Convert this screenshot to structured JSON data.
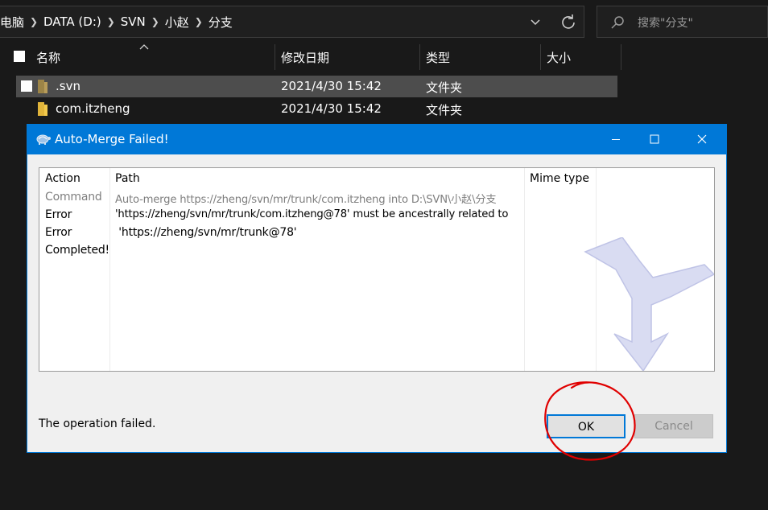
{
  "explorer": {
    "breadcrumbs": [
      "电脑",
      "DATA (D:)",
      "SVN",
      "小赵",
      "分支"
    ],
    "search_placeholder": "搜索\"分支\"",
    "columns": [
      "名称",
      "修改日期",
      "类型",
      "大小"
    ],
    "files": [
      {
        "name": ".svn",
        "date": "2021/4/30 15:42",
        "type": "文件夹",
        "selected": true
      },
      {
        "name": "com.itzheng",
        "date": "2021/4/30 15:42",
        "type": "文件夹",
        "selected": false
      }
    ]
  },
  "dialog": {
    "title": "Auto-Merge Failed!",
    "columns": {
      "action": "Action",
      "path": "Path",
      "mime": "Mime type"
    },
    "rows": [
      {
        "action": "Command",
        "path": "Auto-merge https://zheng/svn/mr/trunk/com.itzheng into D:\\SVN\\小赵\\分支",
        "style": "gray"
      },
      {
        "action": "Error",
        "path": "'https://zheng/svn/mr/trunk/com.itzheng@78' must be ancestrally related to",
        "style": "normal"
      },
      {
        "action": "Error",
        "path": " 'https://zheng/svn/mr/trunk@78'",
        "style": "normal"
      },
      {
        "action": "Completed!",
        "path": "",
        "style": "normal"
      }
    ],
    "status": "The operation failed.",
    "ok_label": "OK",
    "cancel_label": "Cancel"
  },
  "colors": {
    "accent": "#0078d7",
    "annotation": "#e00000",
    "explorer_bg": "#191919",
    "selected_row": "#4d4d4d"
  }
}
